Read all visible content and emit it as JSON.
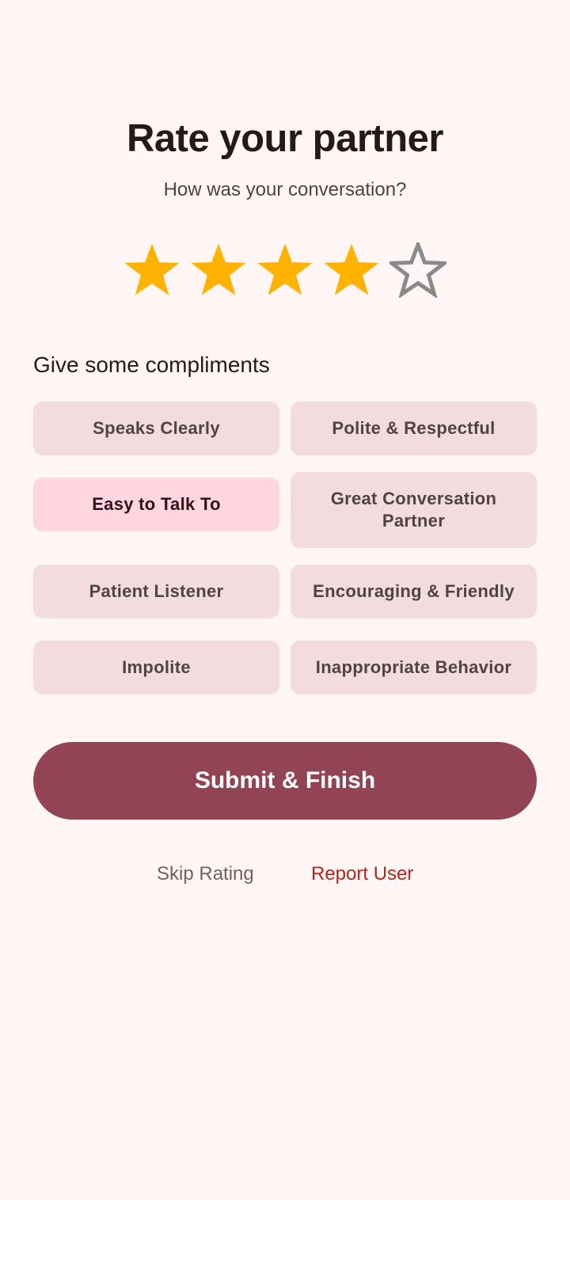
{
  "header": {
    "title": "Rate your partner",
    "subtitle": "How was your conversation?"
  },
  "rating": {
    "value": 4,
    "max": 5,
    "filled_color": "#FFB300",
    "empty_color": "#8A8A8A"
  },
  "compliments": {
    "section_title": "Give some compliments",
    "chips": [
      {
        "label": "Speaks Clearly",
        "selected": false
      },
      {
        "label": "Polite & Respectful",
        "selected": false
      },
      {
        "label": "Easy to Talk To",
        "selected": true
      },
      {
        "label": "Great Conversation Partner",
        "selected": false
      },
      {
        "label": "Patient Listener",
        "selected": false
      },
      {
        "label": "Encouraging & Friendly",
        "selected": false
      },
      {
        "label": "Impolite",
        "selected": false
      },
      {
        "label": "Inappropriate Behavior",
        "selected": false
      }
    ]
  },
  "actions": {
    "submit_label": "Submit & Finish",
    "skip_label": "Skip Rating",
    "report_label": "Report User"
  },
  "colors": {
    "background": "#FFF6F5",
    "primary": "#924455",
    "chip": "#F3DCDD",
    "chip_selected": "#FFD6DF",
    "danger": "#B3261E"
  }
}
